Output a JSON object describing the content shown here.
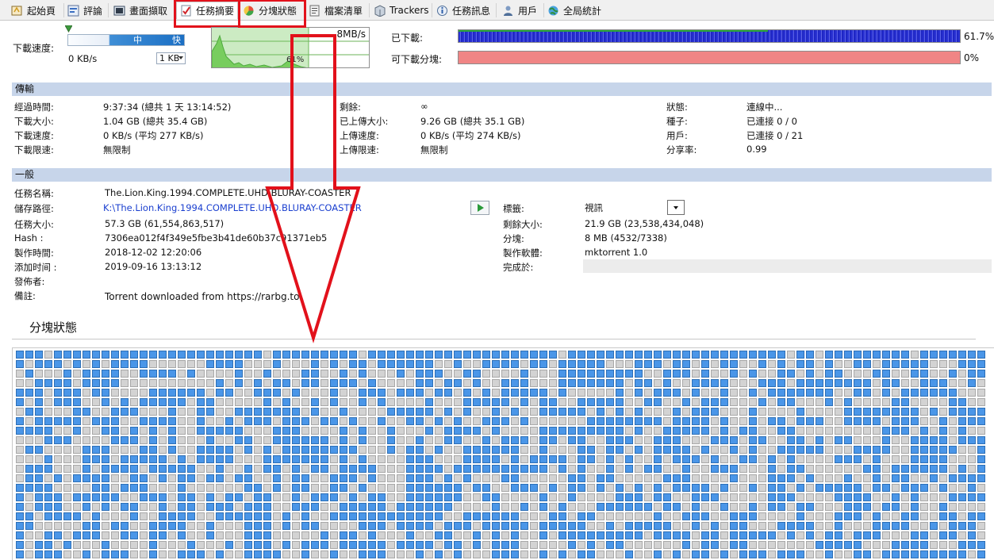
{
  "tabs": [
    {
      "label": "起始頁",
      "icon": "home-icon"
    },
    {
      "label": "評論",
      "icon": "comments-icon"
    },
    {
      "label": "畫面擷取",
      "icon": "screenshot-icon"
    },
    {
      "label": "任務摘要",
      "icon": "checklist-icon",
      "active": true
    },
    {
      "label": "分塊狀態",
      "icon": "pie-chart-icon"
    },
    {
      "label": "檔案清單",
      "icon": "file-list-icon"
    },
    {
      "label": "Trackers",
      "icon": "trackers-icon"
    },
    {
      "label": "任務訊息",
      "icon": "info-icon"
    },
    {
      "label": "用戶",
      "icon": "users-icon"
    },
    {
      "label": "全局統計",
      "icon": "global-stats-icon"
    }
  ],
  "speed": {
    "label": "下載速度:",
    "slider_mid": "中",
    "slider_fast": "快",
    "current": "0 KB/s",
    "unit": "1 KB",
    "graph_max": "8MB/s",
    "graph_percent": "61%"
  },
  "progress": {
    "downloaded_label": "已下載:",
    "downloaded_value": "61.7%",
    "available_label": "可下載分塊:",
    "available_value": "0%",
    "downloaded_fraction": 0.617,
    "colors": {
      "downloaded": "#2a32d3",
      "available": "#f08585"
    }
  },
  "transfer": {
    "header": "傳輸",
    "col1": [
      {
        "k": "經過時間:",
        "v": "9:37:34 (總共 1 天 13:14:52)"
      },
      {
        "k": "下載大小:",
        "v": "1.04 GB (總共 35.4 GB)"
      },
      {
        "k": "下載速度:",
        "v": "0 KB/s (平均 277 KB/s)"
      },
      {
        "k": "下載限速:",
        "v": "無限制"
      }
    ],
    "col2": [
      {
        "k": "剩餘:",
        "v": "∞"
      },
      {
        "k": "已上傳大小:",
        "v": "9.26 GB (總共 35.1 GB)"
      },
      {
        "k": "上傳速度:",
        "v": "0 KB/s (平均 274 KB/s)"
      },
      {
        "k": "上傳限速:",
        "v": "無限制"
      }
    ],
    "col3": [
      {
        "k": "狀態:",
        "v": "連線中..."
      },
      {
        "k": "種子:",
        "v": "已連接 0 / 0"
      },
      {
        "k": "用戶:",
        "v": "已連接 0 / 21"
      },
      {
        "k": "分享率:",
        "v": "0.99"
      }
    ]
  },
  "general": {
    "header": "一般",
    "left": [
      {
        "k": "任務名稱:",
        "v": "The.Lion.King.1994.COMPLETE.UHD.BLURAY-COASTER"
      },
      {
        "k": "儲存路徑:",
        "v": "K:\\The.Lion.King.1994.COMPLETE.UHD.BLURAY-COASTER",
        "link": true
      },
      {
        "k": "任務大小:",
        "v": "57.3 GB (61,554,863,517)"
      },
      {
        "k": "Hash :",
        "v": "7306ea012f4f349e5fbe3b41de60b37c91371eb5"
      },
      {
        "k": "製作時間:",
        "v": "2018-12-02 12:20:06"
      },
      {
        "k": "添加时间 :",
        "v": "2019-09-16 13:13:12"
      },
      {
        "k": "發佈者:",
        "v": ""
      },
      {
        "k": "備註:",
        "v": "Torrent downloaded from https://rarbg.to"
      }
    ],
    "right": [
      {
        "k": "標籤:",
        "v": "視訊"
      },
      {
        "k": "剩餘大小:",
        "v": "21.9 GB (23,538,434,048)"
      },
      {
        "k": "分塊:",
        "v": "8 MB (4532/7338)"
      },
      {
        "k": "製作軟體:",
        "v": "mktorrent 1.0"
      },
      {
        "k": "完成於:",
        "v": ""
      }
    ]
  },
  "pieces": {
    "title": "分塊狀態",
    "colors": {
      "filled": "#4a96e8",
      "empty": "#d3d3d3"
    }
  }
}
